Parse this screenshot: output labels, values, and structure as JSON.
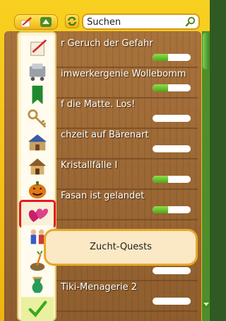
{
  "search": {
    "placeholder": "Suchen",
    "value": ""
  },
  "quests": [
    {
      "title": "r Geruch der Gefahr",
      "progress": 0.4
    },
    {
      "title": "imwerkergenie Wollebomm",
      "progress": 0.4
    },
    {
      "title": "f die Matte. Los!",
      "progress": 0.0
    },
    {
      "title": "chzeit auf Bärenart",
      "progress": 0.0
    },
    {
      "title": "Kristallfälle I",
      "progress": 0.4
    },
    {
      "title": "Fasan ist gelandet",
      "progress": 0.4
    },
    {
      "title": "",
      "progress": 0.0
    },
    {
      "title": "",
      "progress": 0.0
    },
    {
      "title": "Tiki-Menagerie 2",
      "progress": 0.0
    }
  ],
  "filter_menu": {
    "options": [
      {
        "icon": "quill-scroll-icon"
      },
      {
        "icon": "cart-icon"
      },
      {
        "icon": "bookmark-icon"
      },
      {
        "icon": "key-icon"
      },
      {
        "icon": "palace-icon"
      },
      {
        "icon": "house-icon"
      },
      {
        "icon": "pumpkin-icon"
      },
      {
        "icon": "hearts-icon",
        "selected": true
      },
      {
        "icon": "figures-icon"
      },
      {
        "icon": "carrot-pot-icon"
      },
      {
        "icon": "green-vase-icon"
      },
      {
        "icon": "checkmark-icon"
      }
    ]
  },
  "tooltip": {
    "text": "Zucht-Quests"
  },
  "colors": {
    "accent": "#f0b410",
    "progress": "#5bb82a",
    "selection": "#e41c1c"
  }
}
